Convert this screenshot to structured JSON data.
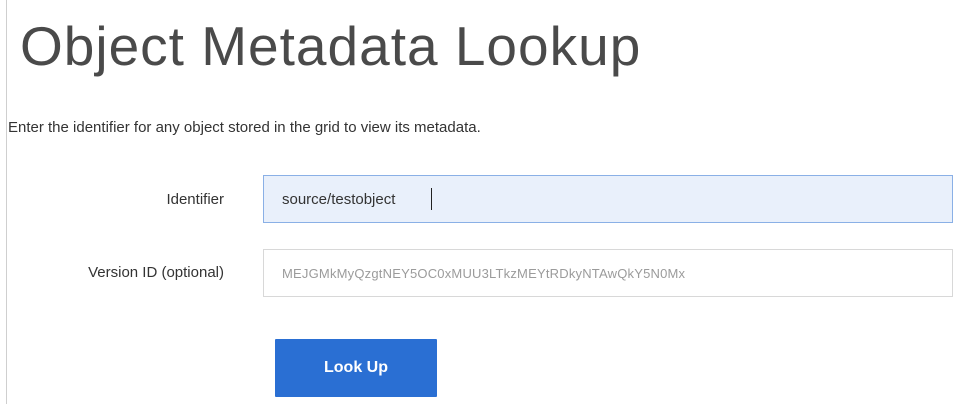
{
  "page": {
    "title": "Object Metadata Lookup",
    "intro": "Enter the identifier for any object stored in the grid to view its metadata."
  },
  "form": {
    "identifier": {
      "label": "Identifier",
      "value": "source/testobject"
    },
    "version_id": {
      "label": "Version ID (optional)",
      "value": "MEJGMkMyQzgtNEY5OC0xMUU3LTkzMEYtRDkyNTAwQkY5N0Mx"
    },
    "submit_label": "Look Up"
  },
  "colors": {
    "accent": "#2a6fd3",
    "title_text": "#4a4a4a",
    "focused_field_bg": "#e9f0fb"
  }
}
